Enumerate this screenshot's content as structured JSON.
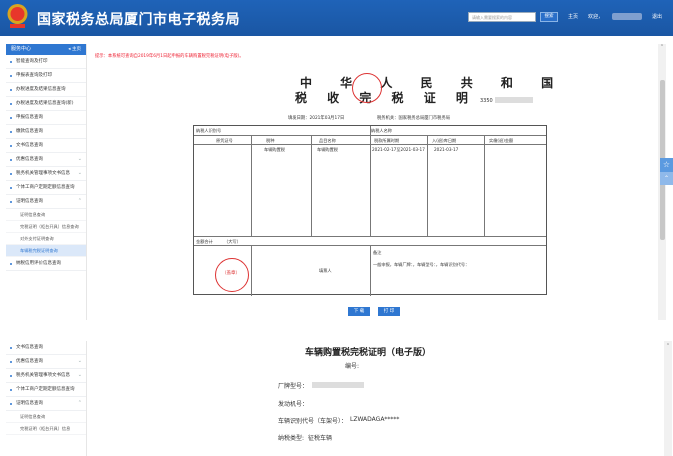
{
  "header": {
    "title": "国家税务总局厦门市电子税务局",
    "search_placeholder": "请输入需要搜索的内容",
    "search_button": "搜索",
    "nav_home": "主页",
    "nav_welcome": "欢迎，",
    "nav_logout": "退出"
  },
  "sidebar": {
    "head_label": "服务中心",
    "back_label": "主页",
    "items": [
      {
        "label": "智能查询及打印"
      },
      {
        "label": "申报表查询及打印"
      },
      {
        "label": "办税进度及结果信息查询"
      },
      {
        "label": "办税进度及结果信息查询(新)"
      },
      {
        "label": "申报信息查询"
      },
      {
        "label": "缴款信息查询"
      },
      {
        "label": "文书信息查询"
      },
      {
        "label": "优惠信息查询"
      },
      {
        "label": "税务机关管理事项文书信息"
      },
      {
        "label": "个体工商户定期定额信息查询"
      },
      {
        "label": "证明信息查询"
      }
    ],
    "subitems": [
      {
        "label": "证明信息查询",
        "active": false
      },
      {
        "label": "完税证明（柜台开具）信息查询",
        "active": false
      },
      {
        "label": "对外支付证明查询",
        "active": false
      },
      {
        "label": "车辆税完税证明查询",
        "active": true
      }
    ],
    "last_item": "纳税信用评价信息查询"
  },
  "notice": "提示：本系统可查询自2019年6月1日起申报的车辆购置税完税证明(电子版)。",
  "certificate": {
    "title_line1": "中 华 人 民 共 和 国",
    "title_line2": "税 收 完 税 证 明",
    "number_prefix": "3350",
    "issue_date": "填发日期：2021年03月17日",
    "tax_office": "税务机关：国家税务总局厦门市税务局",
    "taxpayer_id_label": "纳税人识别号",
    "taxpayer_name_label": "纳税人名称",
    "columns": [
      "原凭证号",
      "税种",
      "品目名称",
      "税款所属时期",
      "入(退)库日期",
      "实缴(退)金额"
    ],
    "row": {
      "tax_type": "车辆购置税",
      "item_name": "车辆购置税",
      "period": "2021-02-17至2021-03-17",
      "storage_date": "2021-03-17"
    },
    "amount_label": "金额合计",
    "amount_currency": "（大写）",
    "stamp_text": "（盖章）",
    "filler_label": "填票人",
    "remark_label": "备注",
    "remark_text": "一般申报，车辆厂牌：，车辆型号：，车辆识别代号：",
    "buttons": {
      "download": "下 载",
      "print": "打 印"
    }
  },
  "bottom": {
    "sidebar_items": [
      {
        "label": "文书信息查询"
      },
      {
        "label": "优惠信息查询"
      },
      {
        "label": "税务机关管理事项文书信息"
      },
      {
        "label": "个体工商户定期定额信息查询"
      },
      {
        "label": "证明信息查询"
      },
      {
        "label": "证明信息查询"
      },
      {
        "label": "完税证明（柜台开具）信息"
      }
    ],
    "title": "车辆购置税完税证明（电子版）",
    "number_label": "编号:",
    "brand_label": "厂牌型号：",
    "engine_label": "发动机号：",
    "vin_label": "车辆识别代号（车架号）：",
    "vin_value": "LZWADAGA*****",
    "tax_type_label": "纳税类型:",
    "tax_type_value": "征税车辆"
  }
}
